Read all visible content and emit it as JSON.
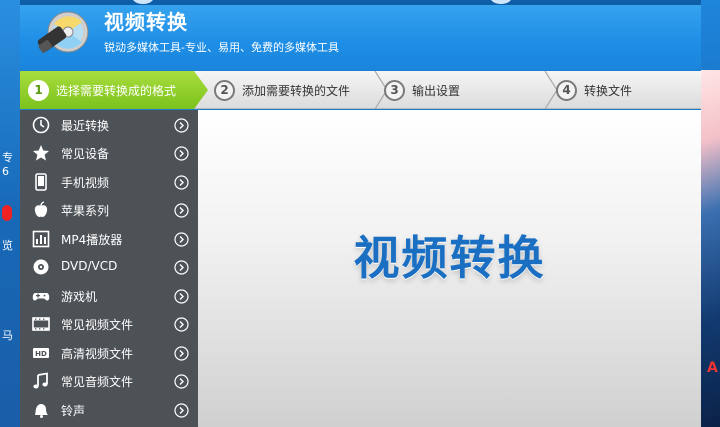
{
  "app": {
    "title": "视频转换",
    "subtitle": "锐动多媒体工具-专业、易用、免费的多媒体工具",
    "main_heading": "视频转换"
  },
  "steps": [
    {
      "num": "1",
      "label": "选择需要转换成的格式",
      "active": true
    },
    {
      "num": "2",
      "label": "添加需要转换的文件",
      "active": false
    },
    {
      "num": "3",
      "label": "输出设置",
      "active": false
    },
    {
      "num": "4",
      "label": "转换文件",
      "active": false
    }
  ],
  "sidebar": {
    "items": [
      {
        "label": "最近转换",
        "icon": "clock-icon"
      },
      {
        "label": "常见设备",
        "icon": "star-icon"
      },
      {
        "label": "手机视频",
        "icon": "phone-icon"
      },
      {
        "label": "苹果系列",
        "icon": "apple-icon"
      },
      {
        "label": "MP4播放器",
        "icon": "mp4-player-icon"
      },
      {
        "label": "DVD/VCD",
        "icon": "disc-icon"
      },
      {
        "label": "游戏机",
        "icon": "gamepad-icon"
      },
      {
        "label": "常见视频文件",
        "icon": "film-icon"
      },
      {
        "label": "高清视频文件",
        "icon": "hd-icon"
      },
      {
        "label": "常见音频文件",
        "icon": "music-note-icon"
      },
      {
        "label": "铃声",
        "icon": "bell-icon"
      }
    ]
  },
  "desktop": {
    "left_fragments": [
      "专",
      "6",
      "览",
      "马"
    ],
    "right_fragment": "A"
  },
  "colors": {
    "header_blue": "#1e8ee6",
    "active_step_green": "#7cc21c",
    "sidebar_bg": "#4d5256",
    "heading_blue": "#1a6fc2"
  }
}
